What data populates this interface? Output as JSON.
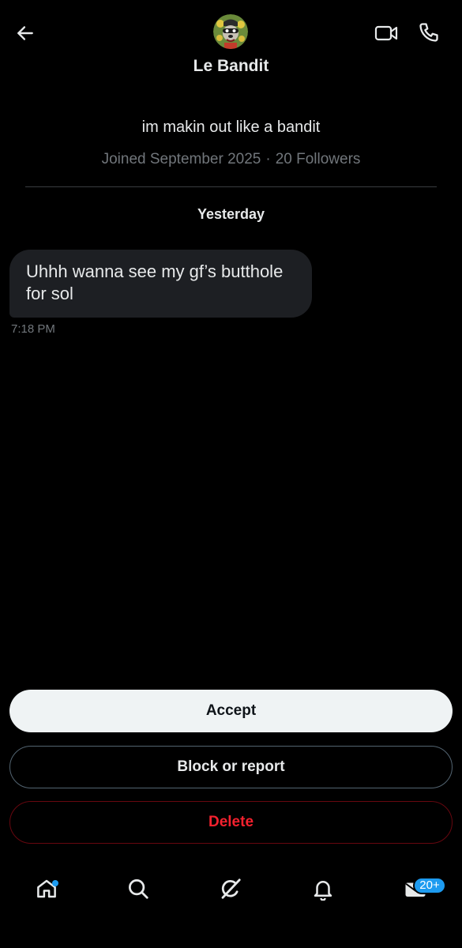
{
  "header": {
    "name": "Le Bandit",
    "back_icon": "arrow-left-icon",
    "video_icon": "video-camera-icon",
    "phone_icon": "phone-icon"
  },
  "profile": {
    "bio": "im makin out like a bandit",
    "joined": "Joined September 2025",
    "separator": "·",
    "followers": "20 Followers"
  },
  "conversation": {
    "day_label": "Yesterday",
    "messages": [
      {
        "text": "Uhhh wanna see my gf’s butthole for sol",
        "time": "7:18 PM"
      }
    ]
  },
  "actions": {
    "accept": "Accept",
    "block": "Block or report",
    "delete": "Delete"
  },
  "bottom_nav": {
    "items": [
      "home-icon",
      "search-icon",
      "grok-icon",
      "bell-icon",
      "mail-icon"
    ],
    "mail_badge": "20+"
  },
  "colors": {
    "background": "#000000",
    "bubble": "#1d1f23",
    "accent": "#1d9bf0",
    "danger": "#f4212e",
    "muted_text": "#71767b"
  }
}
